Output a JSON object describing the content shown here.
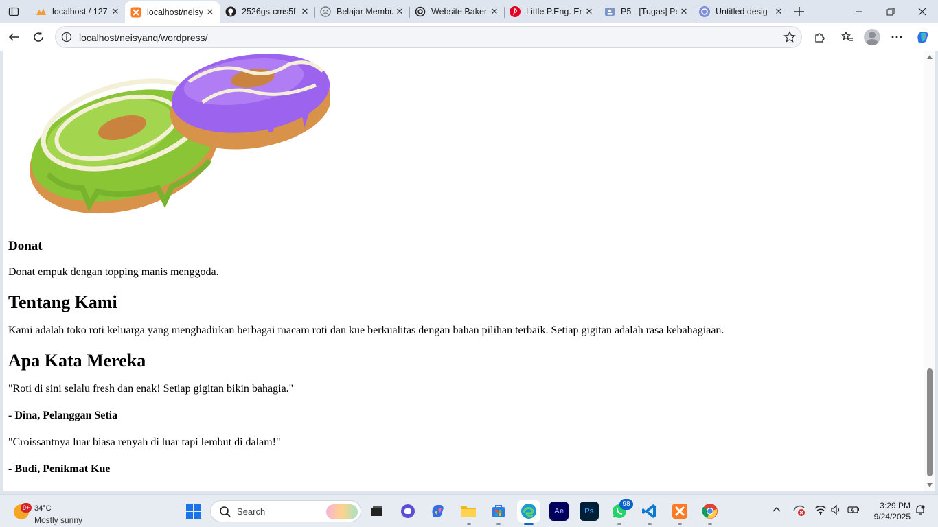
{
  "browser": {
    "tabs": [
      {
        "title": "localhost / 127",
        "icon": "phpmyadmin-icon",
        "active": false
      },
      {
        "title": "localhost/neisy",
        "icon": "xampp-icon",
        "active": true
      },
      {
        "title": "2526gs-cms5f",
        "icon": "github-icon",
        "active": false
      },
      {
        "title": "Belajar Membu",
        "icon": "page-icon",
        "active": false
      },
      {
        "title": "Website Baker",
        "icon": "chatgpt-icon",
        "active": false
      },
      {
        "title": "Little P.Eng. Er",
        "icon": "pinterest-icon",
        "active": false
      },
      {
        "title": "P5 - [Tugas] Pe",
        "icon": "classroom-icon",
        "active": false
      },
      {
        "title": "Untitled desig",
        "icon": "canva-icon",
        "active": false
      }
    ],
    "url": "localhost/neisyanq/wordpress/",
    "accent": "#0a63c9"
  },
  "page": {
    "product": {
      "title": "Donat",
      "description": "Donat empuk dengan topping manis menggoda.",
      "image_alt": "donut-image"
    },
    "about": {
      "heading": "Tentang Kami",
      "text": "Kami adalah toko roti keluarga yang menghadirkan berbagai macam roti dan kue berkualitas dengan bahan pilihan terbaik. Setiap gigitan adalah rasa kebahagiaan."
    },
    "testimonials": {
      "heading": "Apa Kata Mereka",
      "items": [
        {
          "quote": "\"Roti di sini selalu fresh dan enak! Setiap gigitan bikin bahagia.\"",
          "author": "- Dina, Pelanggan Setia"
        },
        {
          "quote": "\"Croissantnya luar biasa renyah di luar tapi lembut di dalam!\"",
          "author": "- Budi, Penikmat Kue"
        }
      ]
    }
  },
  "taskbar": {
    "weather": {
      "badge": "9+",
      "temp": "34°C",
      "condition": "Mostly sunny"
    },
    "search_label": "Search",
    "apps": [
      {
        "name": "task-view",
        "label": ""
      },
      {
        "name": "copilot-chat",
        "label": ""
      },
      {
        "name": "copilot",
        "label": ""
      },
      {
        "name": "file-explorer",
        "label": ""
      },
      {
        "name": "microsoft-store",
        "label": ""
      },
      {
        "name": "edge",
        "label": ""
      },
      {
        "name": "after-effects",
        "label": "Ae"
      },
      {
        "name": "photoshop",
        "label": "Ps"
      },
      {
        "name": "whatsapp",
        "label": ""
      },
      {
        "name": "vscode",
        "label": ""
      },
      {
        "name": "xampp",
        "label": ""
      },
      {
        "name": "chrome",
        "label": ""
      }
    ],
    "whatsapp_badge": "98",
    "time": "3:29 PM",
    "date": "9/24/2025"
  }
}
